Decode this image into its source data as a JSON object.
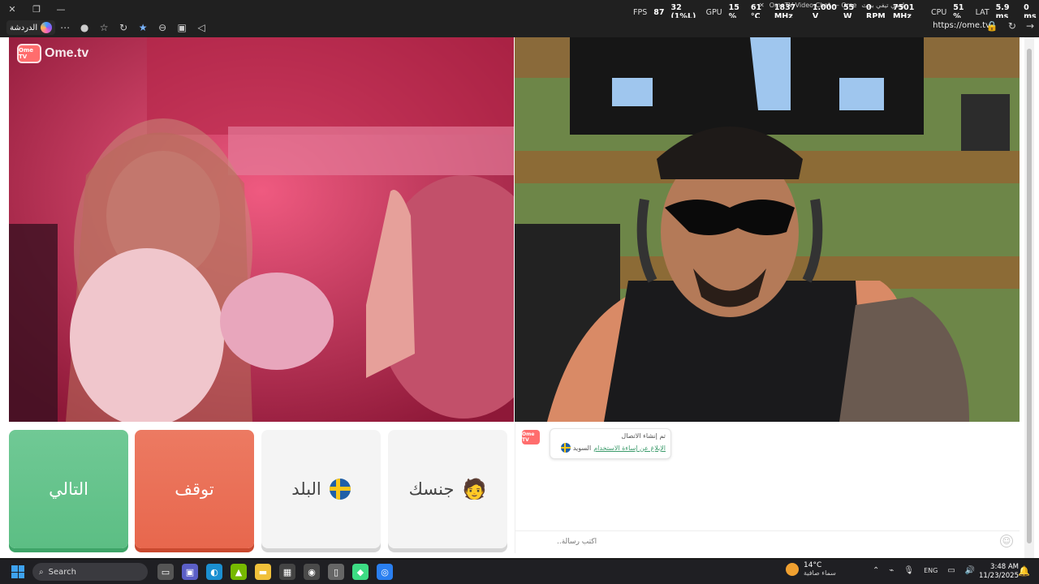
{
  "overlay": {
    "fps_label": "FPS",
    "fps": "87",
    "fps_low": "32 (1%L)",
    "gpu_label": "GPU",
    "gpu_use": "15 %",
    "gpu_temp": "61 °C",
    "gpu_clock": "1837 MHz",
    "gpu_volt": "1.000 V",
    "gpu_power": "55 W",
    "gpu_fan": "0 RPM",
    "gpu_mem": "7501 MHz",
    "cpu_label": "CPU",
    "cpu_use": "51 %",
    "lat_label": "LAT",
    "lat": "5.9 ms",
    "lat2": "0 ms"
  },
  "tabs": {
    "active": "OmeTV Video Chat — Ome",
    "search": "اومي تيفي بحث"
  },
  "toolbar": {
    "chat_button": "الدردشة",
    "url": "https://ome.tv"
  },
  "logo": {
    "box": "Ome TV",
    "text": "Ome.tv"
  },
  "buttons": {
    "next": "التالي",
    "stop": "توقف",
    "country": "البلد",
    "gender": "جنسك",
    "gender_icon": "🧑"
  },
  "chat": {
    "avatar": "Ome TV",
    "msg_line1": "تم إنشاء الاتصال",
    "msg_link": "الإبلاغ عن إساءة الاستخدام",
    "msg_country": "السويد",
    "input_placeholder": "اكتب رسالة..",
    "emoji_icon": "☺"
  },
  "taskbar": {
    "search": "Search",
    "temp": "14°C",
    "weather": "سماء صافية",
    "lang": "ENG",
    "time": "3:48 AM",
    "date": "11/23/2025"
  }
}
